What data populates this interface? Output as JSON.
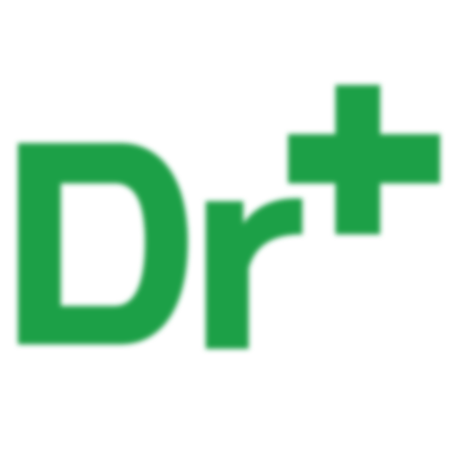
{
  "logo": {
    "text": "Dr+",
    "color": "#1fa046",
    "background": "#ffffff"
  }
}
